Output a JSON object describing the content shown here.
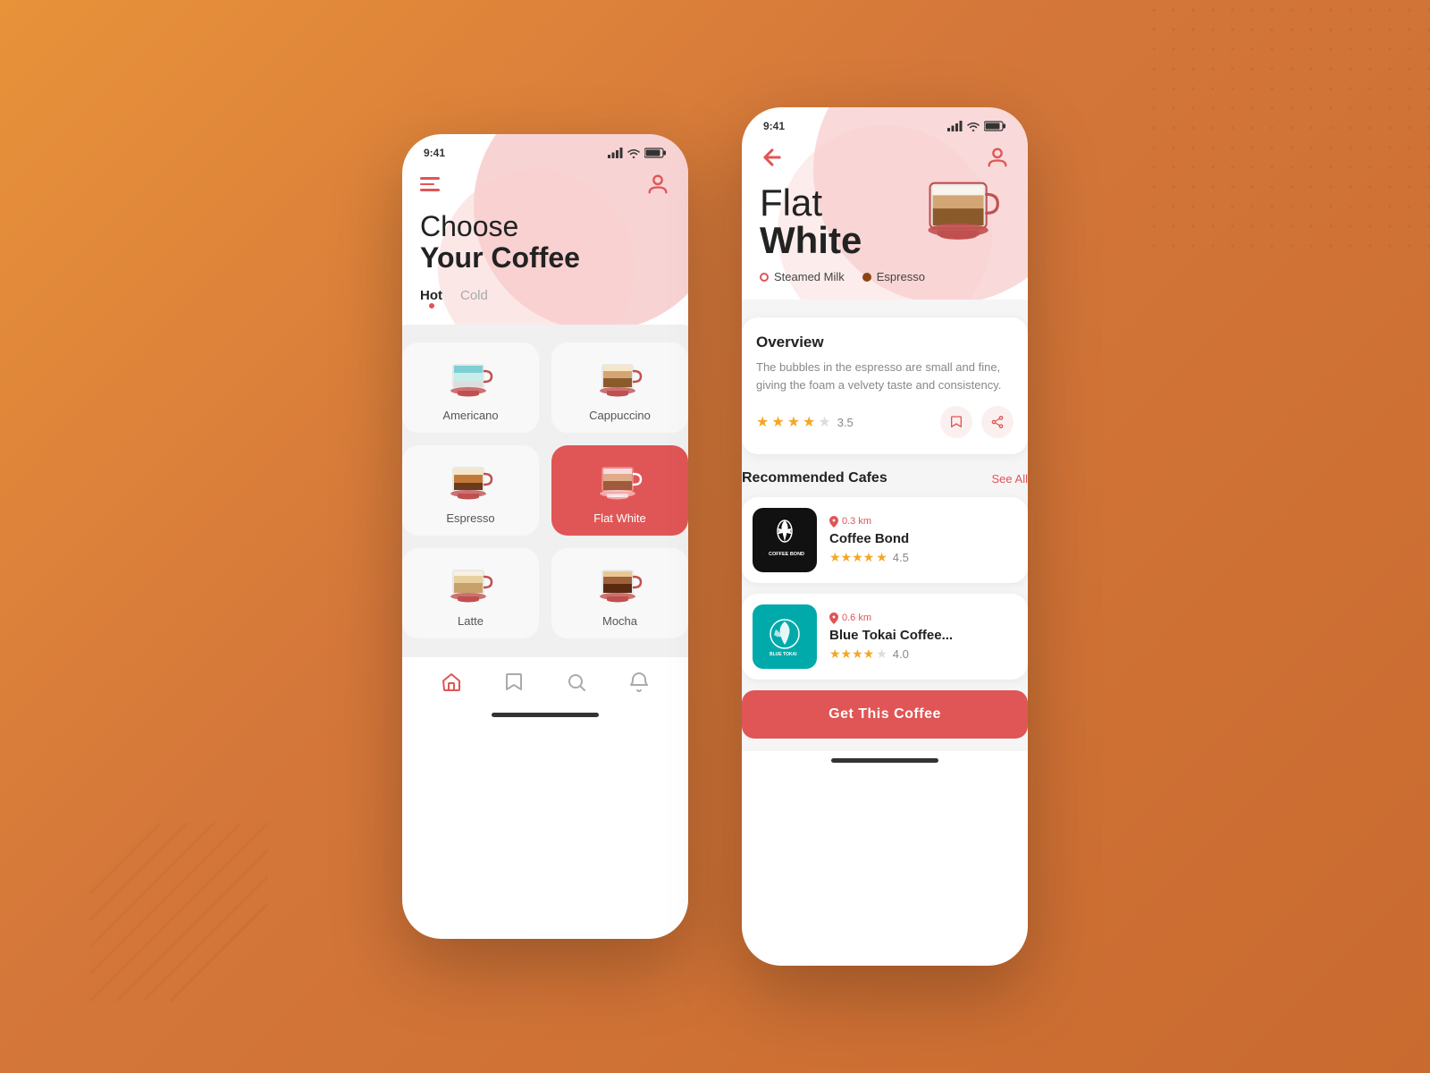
{
  "background": {
    "color": "#d4773a"
  },
  "phone1": {
    "status_time": "9:41",
    "title_line1": "Choose",
    "title_line2": "Your Coffee",
    "tabs": [
      {
        "label": "Hot",
        "active": true
      },
      {
        "label": "Cold",
        "active": false
      }
    ],
    "coffees": [
      {
        "name": "Americano",
        "selected": false,
        "cup_type": "americano"
      },
      {
        "name": "Cappuccino",
        "selected": false,
        "cup_type": "cappuccino"
      },
      {
        "name": "Espresso",
        "selected": false,
        "cup_type": "espresso"
      },
      {
        "name": "Flat White",
        "selected": true,
        "cup_type": "flatwhite"
      },
      {
        "name": "Latte",
        "selected": false,
        "cup_type": "latte"
      },
      {
        "name": "Mocha",
        "selected": false,
        "cup_type": "mocha"
      }
    ],
    "nav": [
      "home",
      "bookmark",
      "search",
      "bell"
    ]
  },
  "phone2": {
    "status_time": "9:41",
    "title_line1": "Flat",
    "title_line2": "White",
    "ingredients": [
      {
        "name": "Steamed Milk",
        "dot_type": "milk"
      },
      {
        "name": "Espresso",
        "dot_type": "espresso"
      }
    ],
    "overview": {
      "title": "Overview",
      "text": "The bubbles in the espresso are small and fine, giving the foam a velvety taste and consistency.",
      "rating": "3.5"
    },
    "recommended_title": "Recommended Cafes",
    "see_all": "See All",
    "cafes": [
      {
        "name": "Coffee Bond",
        "distance": "0.3 km",
        "rating": "4.5",
        "logo_type": "bond"
      },
      {
        "name": "Blue Tokai Coffee...",
        "distance": "0.6 km",
        "rating": "4.0",
        "logo_type": "tokai"
      }
    ],
    "cta_button": "Get This Coffee"
  }
}
